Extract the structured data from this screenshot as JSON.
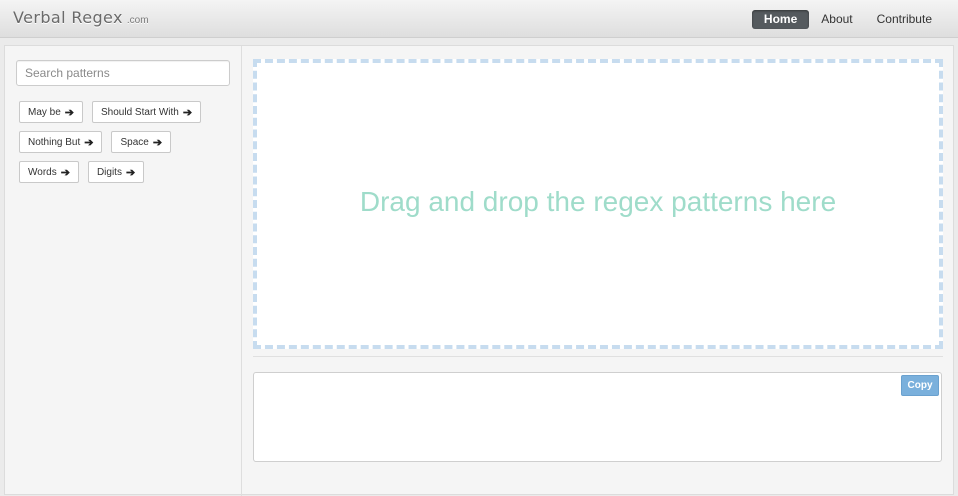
{
  "brand": {
    "name": "Verbal Regex",
    "suffix": ".com"
  },
  "nav": {
    "items": [
      {
        "label": "Home",
        "active": true
      },
      {
        "label": "About",
        "active": false
      },
      {
        "label": "Contribute",
        "active": false
      }
    ]
  },
  "sidebar": {
    "search_placeholder": "Search patterns",
    "patterns": [
      {
        "label": "May be",
        "icon": "arrow-right-icon"
      },
      {
        "label": "Should Start With",
        "icon": "arrow-right-icon"
      },
      {
        "label": "Nothing But",
        "icon": "arrow-right-icon"
      },
      {
        "label": "Space",
        "icon": "arrow-right-icon"
      },
      {
        "label": "Words",
        "icon": "arrow-right-icon"
      },
      {
        "label": "Digits",
        "icon": "arrow-right-icon"
      }
    ]
  },
  "dropzone": {
    "text": "Drag and drop the regex patterns here"
  },
  "output": {
    "copy_label": "Copy",
    "value": ""
  },
  "colors": {
    "nav_active_bg": "#555a5e",
    "drop_text": "#9fdcca",
    "drop_border": "#c7dcef",
    "copy_button": "#7ab0dc"
  }
}
